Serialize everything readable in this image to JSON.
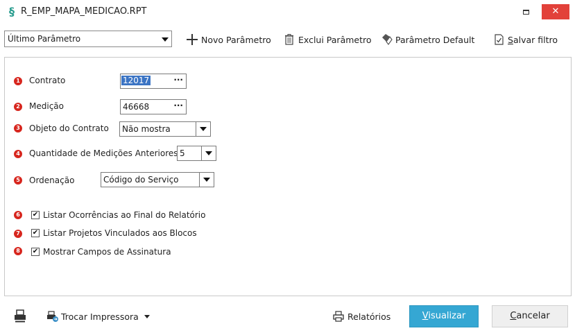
{
  "window": {
    "title": "R_EMP_MAPA_MEDICAO.RPT",
    "close_label": "✕"
  },
  "toolbar": {
    "param_select": "Último Parâmetro",
    "novo": "Novo Parâmetro",
    "exclui": "Exclui Parâmetro",
    "default": "Parâmetro Default",
    "salvar_first": "S",
    "salvar_rest": "alvar filtro"
  },
  "params": [
    {
      "n": "1",
      "label": "Contrato",
      "value": "12017"
    },
    {
      "n": "2",
      "label": "Medição",
      "value": "46668"
    },
    {
      "n": "3",
      "label": "Objeto do Contrato",
      "value": "Não mostra"
    },
    {
      "n": "4",
      "label": "Quantidade de Medições Anteriores",
      "value": "5"
    },
    {
      "n": "5",
      "label": "Ordenação",
      "value": "Código do Serviço"
    }
  ],
  "options": [
    {
      "n": "6",
      "label": "Listar Ocorrências ao Final do Relatório",
      "checked": true
    },
    {
      "n": "7",
      "label": "Listar Projetos Vinculados aos Blocos",
      "checked": true
    },
    {
      "n": "8",
      "label": "Mostrar Campos de Assinatura",
      "checked": true
    }
  ],
  "dots": "···",
  "check_mark": "✔",
  "footer": {
    "trocar": "Trocar Impressora",
    "relatorios": "Relatórios",
    "visualizar_first": "V",
    "visualizar_rest": "isualizar",
    "cancelar_first": "C",
    "cancelar_rest": "ancelar"
  },
  "colors": {
    "accent": "#35a7d3",
    "badge": "#d7261e",
    "close": "#e2413a"
  }
}
